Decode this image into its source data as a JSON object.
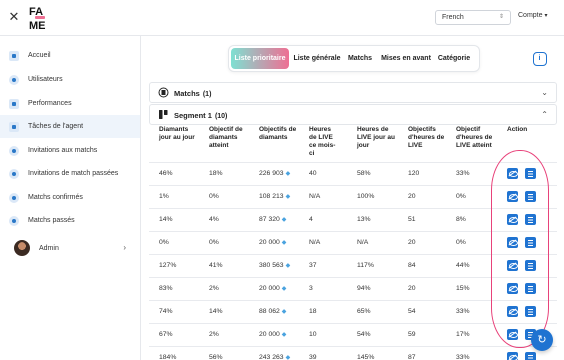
{
  "header": {
    "logo_text": "FAME",
    "language": "French",
    "account_label": "Compte"
  },
  "sidebar": {
    "items": [
      {
        "label": "Accueil",
        "icon": "home-icon"
      },
      {
        "label": "Utilisateurs",
        "icon": "user-icon"
      },
      {
        "label": "Performances",
        "icon": "chart-icon"
      },
      {
        "label": "Tâches de l'agent",
        "icon": "tasks-icon",
        "active": true
      },
      {
        "label": "Invitations aux matchs",
        "icon": "invite-icon"
      },
      {
        "label": "Invitations de match passées",
        "icon": "invite-icon"
      },
      {
        "label": "Matchs confirmés",
        "icon": "invite-icon"
      },
      {
        "label": "Matchs passés",
        "icon": "invite-icon"
      }
    ],
    "admin_label": "Admin"
  },
  "tabs": [
    "Liste prioritaire",
    "Liste générale",
    "Matchs",
    "Mises en avant",
    "Catégorie"
  ],
  "accordions": {
    "matchs": {
      "title": "Matchs",
      "count": "(1)"
    },
    "segment": {
      "title": "Segment 1",
      "count": "(10)"
    }
  },
  "table": {
    "headers": [
      "Diamants jour au jour",
      "Objectif de diamants atteint",
      "Objectifs de diamants",
      "Heures de LIVE ce mois-ci",
      "Heures de LIVE jour au jour",
      "Objectifs d'heures de LIVE",
      "Objectif d'heures de LIVE atteint",
      "Action"
    ],
    "rows": [
      [
        "46%",
        "18%",
        "226 903",
        "40",
        "58%",
        "120",
        "33%"
      ],
      [
        "1%",
        "0%",
        "108 213",
        "N/A",
        "100%",
        "20",
        "0%"
      ],
      [
        "14%",
        "4%",
        "87 320",
        "4",
        "13%",
        "51",
        "8%"
      ],
      [
        "0%",
        "0%",
        "20 000",
        "N/A",
        "N/A",
        "20",
        "0%"
      ],
      [
        "127%",
        "41%",
        "380 563",
        "37",
        "117%",
        "84",
        "44%"
      ],
      [
        "83%",
        "2%",
        "20 000",
        "3",
        "94%",
        "20",
        "15%"
      ],
      [
        "74%",
        "14%",
        "88 062",
        "18",
        "65%",
        "54",
        "33%"
      ],
      [
        "67%",
        "2%",
        "20 000",
        "10",
        "54%",
        "59",
        "17%"
      ],
      [
        "184%",
        "56%",
        "243 263",
        "39",
        "145%",
        "87",
        "33%"
      ]
    ]
  },
  "colors": {
    "accent_blue": "#1f73d1",
    "tab_gradient_start": "#7ee0d2",
    "tab_gradient_end": "#ee6f93",
    "highlight_pink": "#e8427a"
  }
}
